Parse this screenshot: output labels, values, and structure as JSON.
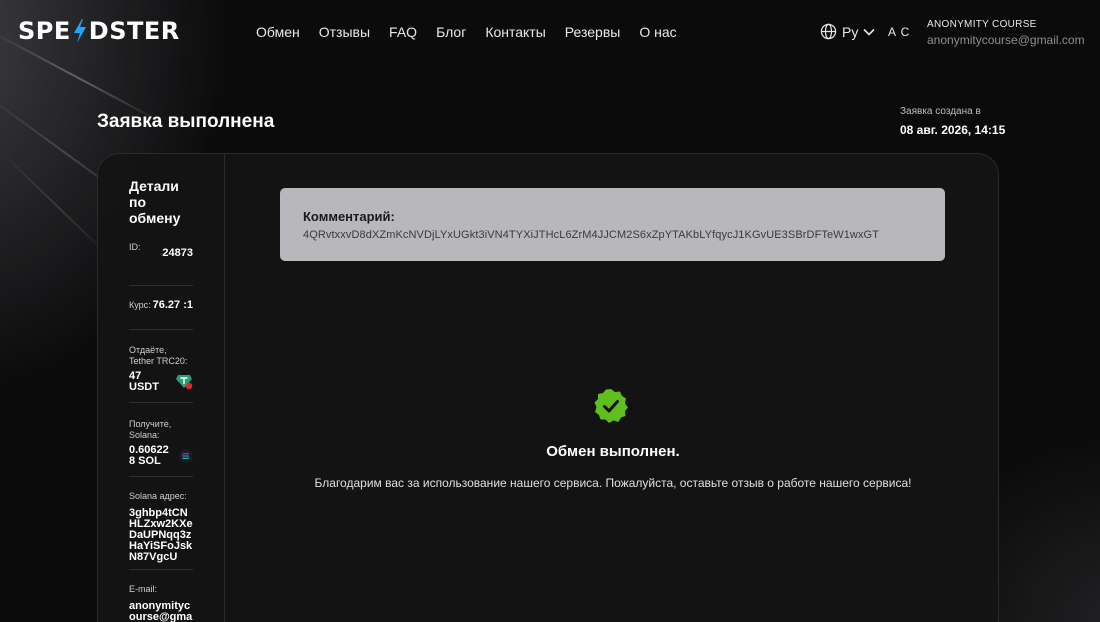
{
  "brand": {
    "logo_left": "SPE",
    "logo_right": "DSTER"
  },
  "nav": [
    {
      "label": "Обмен"
    },
    {
      "label": "Отзывы"
    },
    {
      "label": "FAQ"
    },
    {
      "label": "Блог"
    },
    {
      "label": "Контакты"
    },
    {
      "label": "Резервы"
    },
    {
      "label": "О нас"
    }
  ],
  "lang": {
    "current": "Ру",
    "icon": "globe-icon"
  },
  "user": {
    "initials": "A C",
    "name": "ANONYMITY COURSE",
    "email": "anonymitycourse@gmail.com"
  },
  "page": {
    "title": "Заявка выполнена",
    "created_label": "Заявка создана в",
    "created_date": "08 авг. 2026, 14:15"
  },
  "details": {
    "title": "Детали по обмену",
    "id_label": "ID:",
    "id_value": "24873",
    "rate_label": "Курс:",
    "rate_value": "76.27 :1",
    "give_label": "Отдаёте, Tether TRC20:",
    "give_value": "47 USDT",
    "receive_label": "Получите, Solana:",
    "receive_value": "0.606228 SOL",
    "address_label": "Solana адрес:",
    "address_value": "3ghbp4tCNHLZxw2KXeDaUPNqq3zHaYiSFoJskN87VgcU",
    "email_label": "E-mail:",
    "email_value": "anonymitycourse@gmail.com"
  },
  "comment": {
    "label": "Комментарий:",
    "text": "4QRvtxxvD8dXZmKcNVDjLYxUGkt3iVN4TYXiJTHcL6ZrM4JJCM2S6xZpYTAKbLYfqycJ1KGvUE3SBrDFTeW1wxGT"
  },
  "status": {
    "title": "Обмен выполнен.",
    "message": "Благодарим вас за использование нашего сервиса. Пожалуйста, оставьте отзыв о работе нашего сервиса!"
  },
  "colors": {
    "success": "#5fbf1f",
    "tether": "#26a17b",
    "accent": "#1ea7ff"
  }
}
